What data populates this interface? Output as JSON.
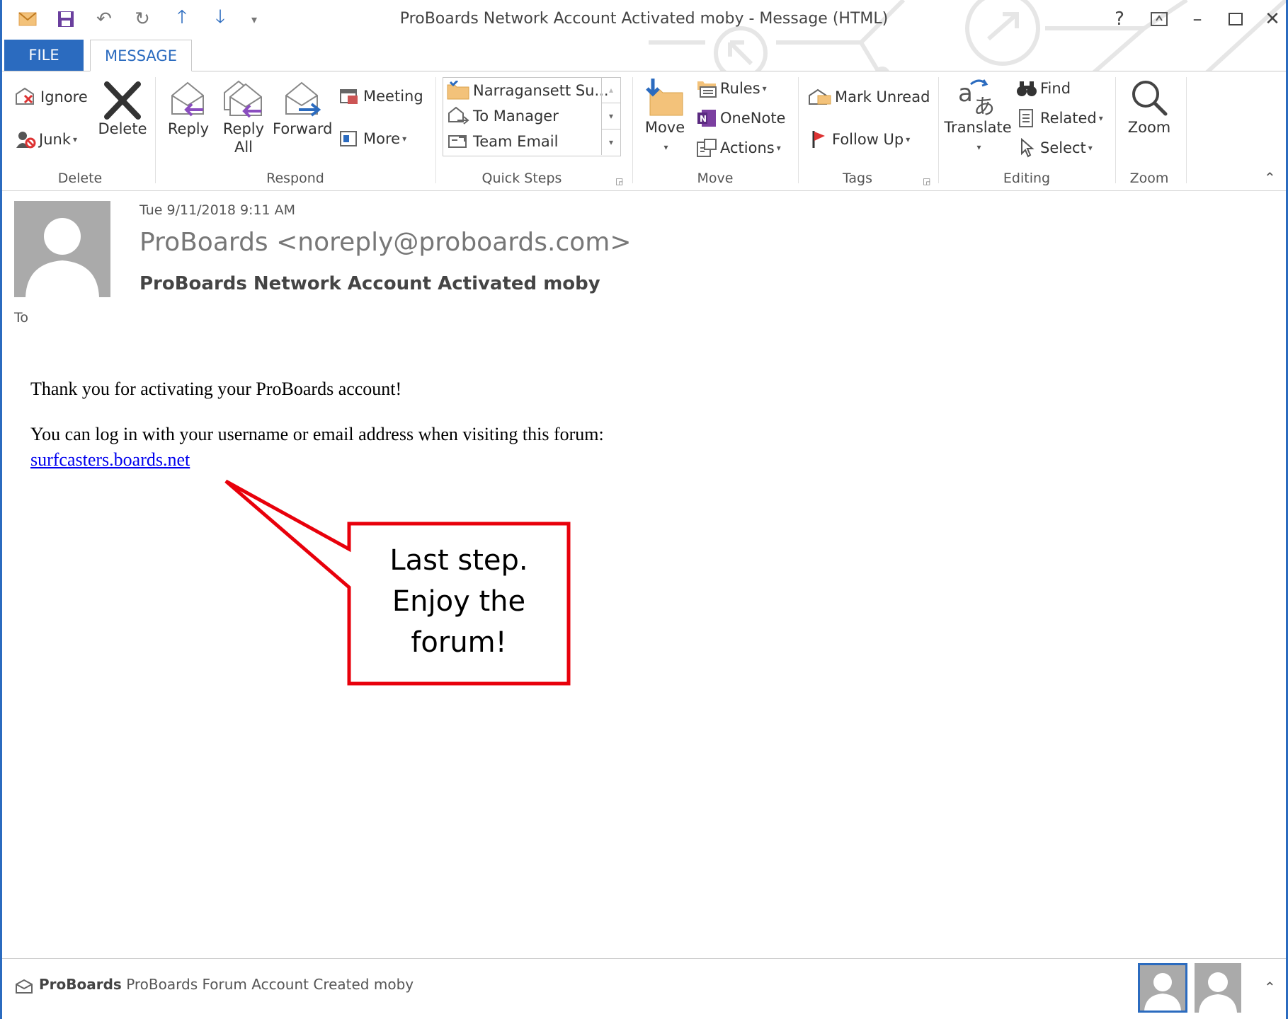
{
  "window": {
    "title": "ProBoards Network Account Activated moby - Message (HTML)",
    "help": "?",
    "minimize": "–",
    "close": "✕"
  },
  "tabs": {
    "file": "FILE",
    "message": "MESSAGE"
  },
  "ribbon": {
    "delete_group": {
      "label": "Delete",
      "ignore": "Ignore",
      "junk": "Junk",
      "delete": "Delete"
    },
    "respond_group": {
      "label": "Respond",
      "reply": "Reply",
      "reply_all_1": "Reply",
      "reply_all_2": "All",
      "forward": "Forward",
      "meeting": "Meeting",
      "more": "More"
    },
    "quick_steps_group": {
      "label": "Quick Steps",
      "items": [
        "Narragansett Su...",
        "To Manager",
        "Team Email"
      ]
    },
    "move_group": {
      "label": "Move",
      "move": "Move",
      "rules": "Rules",
      "onenote": "OneNote",
      "actions": "Actions"
    },
    "tags_group": {
      "label": "Tags",
      "mark_unread": "Mark Unread",
      "follow_up": "Follow Up"
    },
    "editing_group": {
      "label": "Editing",
      "translate": "Translate",
      "find": "Find",
      "related": "Related",
      "select": "Select"
    },
    "zoom_group": {
      "label": "Zoom",
      "zoom": "Zoom"
    }
  },
  "message": {
    "date": "Tue 9/11/2018 9:11 AM",
    "from": "ProBoards <noreply@proboards.com>",
    "subject": "ProBoards Network Account Activated moby",
    "to_label": "To",
    "body_line1": "Thank you for activating your ProBoards account!",
    "body_line2": "You can log in with your username or email address when visiting this forum:",
    "link": "surfcasters.boards.net"
  },
  "callout": {
    "text": "Last step.\nEnjoy the\nforum!",
    "border_color": "#e8000b"
  },
  "people_pane": {
    "sender": "ProBoards",
    "subject": "ProBoards Forum Account Created moby"
  },
  "colors": {
    "accent": "#2b6bbf",
    "link": "#0000ee"
  }
}
